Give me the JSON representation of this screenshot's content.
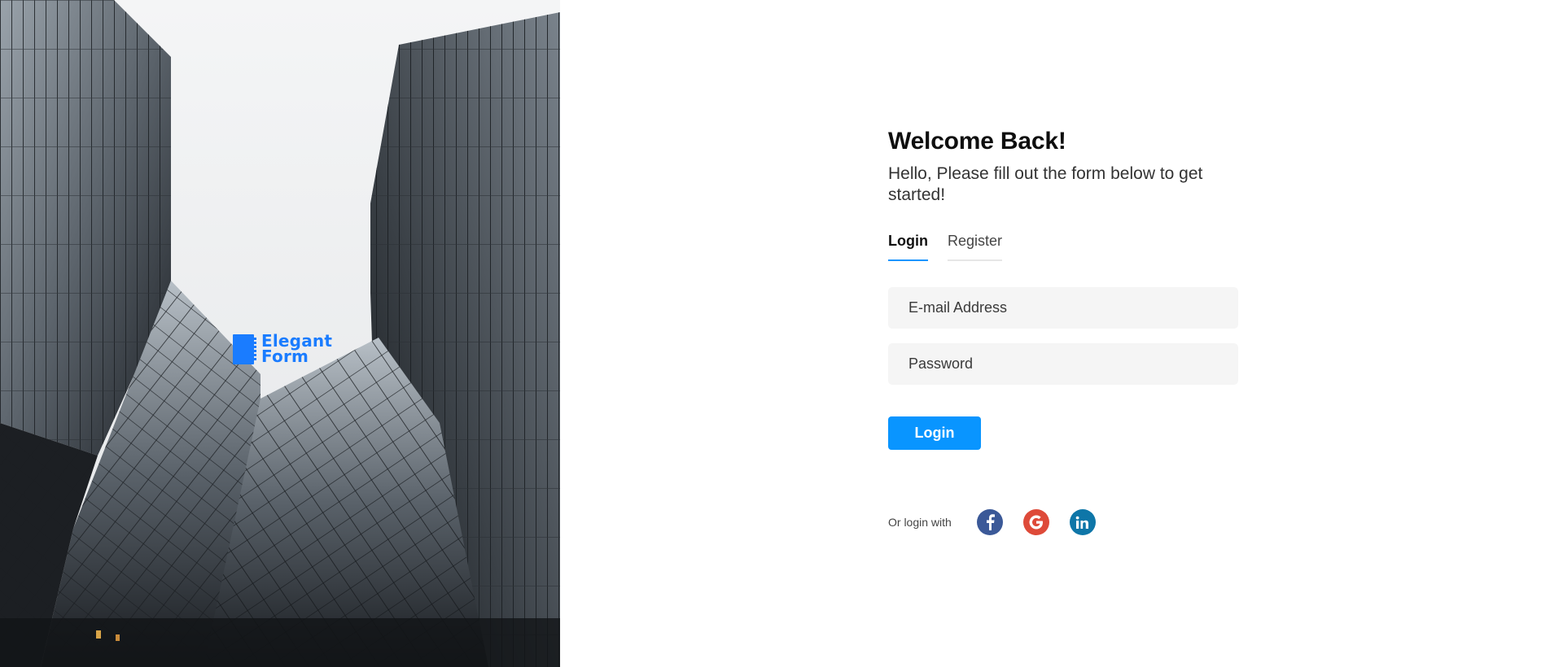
{
  "brand": {
    "line1": "Elegant",
    "line2": "Form"
  },
  "form": {
    "title": "Welcome Back!",
    "subtitle": "Hello, Please fill out the form below to get started!",
    "tabs": [
      {
        "label": "Login",
        "active": true
      },
      {
        "label": "Register",
        "active": false
      }
    ],
    "email_placeholder": "E-mail Address",
    "password_placeholder": "Password",
    "submit_label": "Login",
    "social_label": "Or login with",
    "social": [
      {
        "name": "facebook-icon",
        "color": "#3b5998"
      },
      {
        "name": "google-icon",
        "color": "#de4a39"
      },
      {
        "name": "linkedin-icon",
        "color": "#0e76a8"
      }
    ]
  },
  "colors": {
    "accent": "#0995ff",
    "brand": "#1a7cff",
    "field_bg": "#f5f5f5"
  }
}
